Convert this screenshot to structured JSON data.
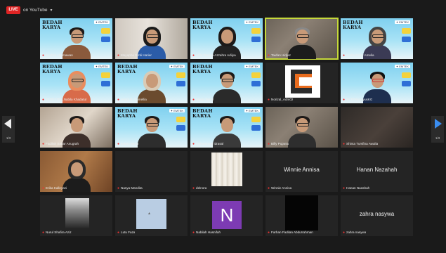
{
  "topbar": {
    "live": "LIVE",
    "platform": "on YouTube"
  },
  "banner": {
    "title": "BEDAH KARYA",
    "sponsor": "✦ EMTEK"
  },
  "nav": {
    "left_count": "1/3",
    "right_count": "1/3"
  },
  "participants": [
    "Ibrahim Hermawan",
    "Mayapha Rizki Harier",
    "Afifa Tsanaa Azzahra Adiiya",
    "Taufan Hidjaz",
    "Nadia Rizky Amelia",
    "212017205_Nabila Khadatul",
    "Anggi R. Camellia",
    "Mang Jamal",
    "Norizal_Adm02",
    "DI TENAS IyusKG",
    "Fadilah Sabar Anugrah",
    "Edwin Widia",
    "muhammad idrasal",
    "Billy Pujanto",
    "Shinta Tursfina Awalia",
    "Erika Kalleyani",
    "Nasya Mandita",
    "delnora",
    "Winnie Annisa",
    "Hanan Nazahah",
    "Nurul Shafira Aziz",
    "Lutu Faza",
    "Nabilah Hasnifah",
    "Farhan Fadilan Abdurrahman",
    "zahra nasywa"
  ],
  "display_names": {
    "winnie": "Winnie Annisa",
    "hanan": "Hanan Nazahah",
    "zahra": "zahra nasywa"
  },
  "avatar_letter": "N",
  "active_speaker_color": "#c6d93a"
}
